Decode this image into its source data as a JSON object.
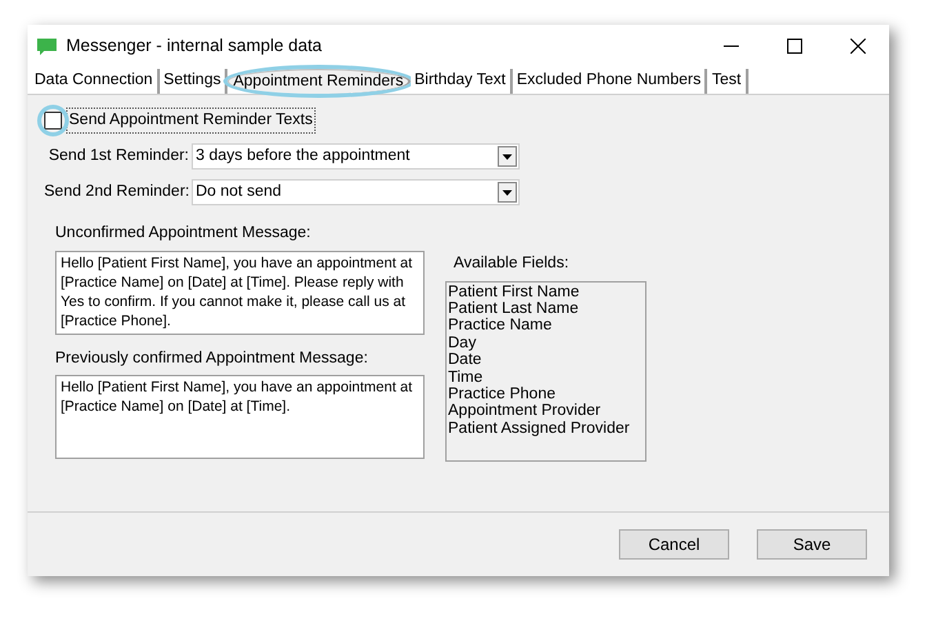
{
  "window": {
    "title": "Messenger - internal sample data"
  },
  "tabs": [
    {
      "label": "Data Connection",
      "selected": false,
      "circled": false
    },
    {
      "label": "Settings",
      "selected": false,
      "circled": false
    },
    {
      "label": "Appointment Reminders",
      "selected": true,
      "circled": true
    },
    {
      "label": "Birthday Text",
      "selected": false,
      "circled": false
    },
    {
      "label": "Excluded Phone Numbers",
      "selected": false,
      "circled": false
    },
    {
      "label": "Test",
      "selected": false,
      "circled": false
    }
  ],
  "enable": {
    "label": "Send Appointment Reminder Texts",
    "checked": false,
    "circled": true
  },
  "reminders": [
    {
      "label": "Send 1st Reminder:",
      "value": "3 days before the appointment"
    },
    {
      "label": "Send 2nd Reminder:",
      "value": "Do not send"
    }
  ],
  "messages": [
    {
      "label": "Unconfirmed Appointment Message:",
      "value": "Hello [Patient First Name], you have an appointment at [Practice Name] on [Date] at [Time].  Please reply with Yes to confirm.  If you cannot make it, please call us at [Practice Phone]."
    },
    {
      "label": "Previously confirmed Appointment Message:",
      "value": "Hello [Patient First Name], you have an appointment at [Practice Name] on [Date] at [Time]."
    }
  ],
  "available_fields": {
    "label": "Available Fields:",
    "items": [
      "Patient First Name",
      "Patient Last Name",
      "Practice Name",
      "Day",
      "Date",
      "Time",
      "Practice Phone",
      "Appointment Provider",
      "Patient Assigned Provider"
    ]
  },
  "buttons": [
    "Cancel",
    "Save"
  ]
}
